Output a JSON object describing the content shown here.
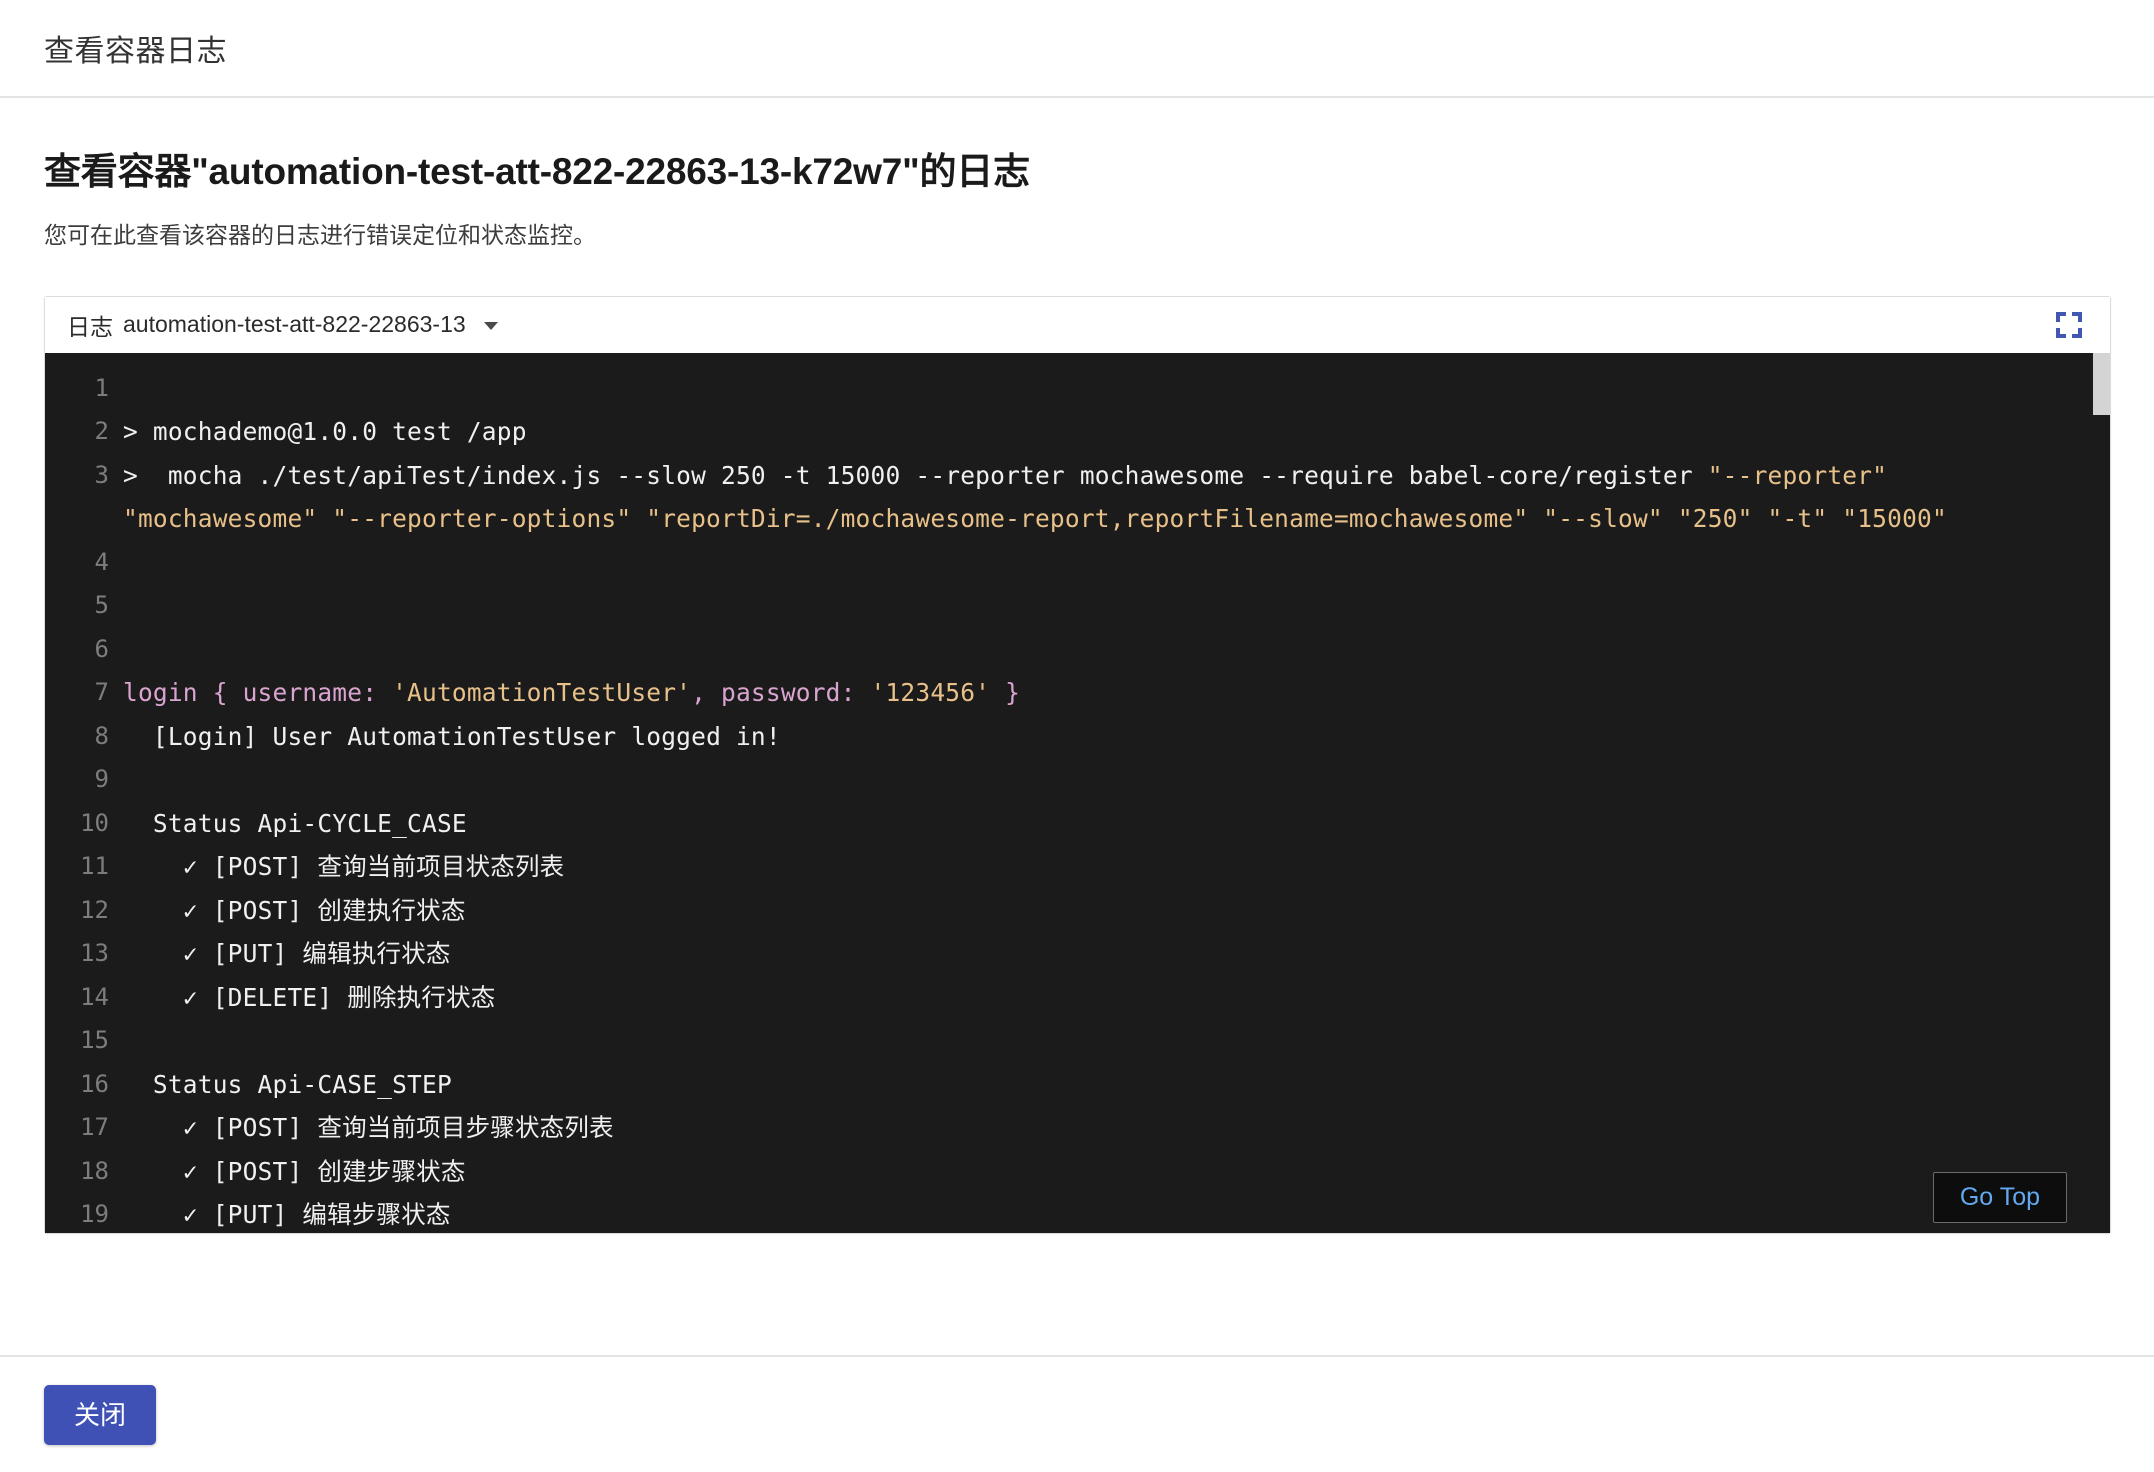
{
  "header": {
    "title": "查看容器日志"
  },
  "main": {
    "page_title": "查看容器\"automation-test-att-822-22863-13-k72w7\"的日志",
    "subtitle": "您可在此查看该容器的日志进行错误定位和状态监控。"
  },
  "log_panel": {
    "selector_label": "日志",
    "selector_value": "automation-test-att-822-22863-13",
    "caret_icon": "chevron-down-icon",
    "fullscreen_icon": "fullscreen-icon",
    "go_top_label": "Go Top",
    "scrollbar": {
      "thumb_position_pct": 0
    }
  },
  "footer": {
    "close_label": "关闭"
  },
  "colors": {
    "accent": "#3f51b5",
    "console_bg": "#1b1b1b",
    "console_text": "#d8d8d8",
    "string_orange": "#e8c08a",
    "keyword_purple": "#d9a5d0",
    "link_blue": "#62a9f0",
    "gutter_text": "#7d7d7d"
  },
  "log_lines": [
    {
      "num": "1",
      "segments": []
    },
    {
      "num": "2",
      "segments": [
        {
          "color": "white",
          "text": "> mochademo@1.0.0 test /app"
        }
      ]
    },
    {
      "num": "3",
      "segments": [
        {
          "color": "white",
          "text": ">  mocha ./test/apiTest/index.js --slow 250 -t 15000 --reporter mochawesome --require babel-core/register "
        },
        {
          "color": "orange",
          "text": "\"--reporter\" \"mochawesome\" \"--reporter-options\" \"reportDir=./mochawesome-report,reportFilename=mochawesome\" \"--slow\" \"250\" \"-t\" \"15000\""
        }
      ]
    },
    {
      "num": "4",
      "segments": []
    },
    {
      "num": "5",
      "segments": []
    },
    {
      "num": "6",
      "segments": []
    },
    {
      "num": "7",
      "segments": [
        {
          "color": "purple",
          "text": "login { username: "
        },
        {
          "color": "orange",
          "text": "'AutomationTestUser'"
        },
        {
          "color": "purple",
          "text": ", password: "
        },
        {
          "color": "orange",
          "text": "'123456'"
        },
        {
          "color": "purple",
          "text": " }"
        }
      ]
    },
    {
      "num": "8",
      "segments": [
        {
          "color": "white",
          "text": "  [Login] User AutomationTestUser logged in!"
        }
      ]
    },
    {
      "num": "9",
      "segments": []
    },
    {
      "num": "10",
      "segments": [
        {
          "color": "white",
          "text": "  Status Api-CYCLE_CASE"
        }
      ]
    },
    {
      "num": "11",
      "segments": [
        {
          "color": "white",
          "text": "    ✓ [POST] 查询当前项目状态列表"
        }
      ]
    },
    {
      "num": "12",
      "segments": [
        {
          "color": "white",
          "text": "    ✓ [POST] 创建执行状态"
        }
      ]
    },
    {
      "num": "13",
      "segments": [
        {
          "color": "white",
          "text": "    ✓ [PUT] 编辑执行状态"
        }
      ]
    },
    {
      "num": "14",
      "segments": [
        {
          "color": "white",
          "text": "    ✓ [DELETE] 删除执行状态"
        }
      ]
    },
    {
      "num": "15",
      "segments": []
    },
    {
      "num": "16",
      "segments": [
        {
          "color": "white",
          "text": "  Status Api-CASE_STEP"
        }
      ]
    },
    {
      "num": "17",
      "segments": [
        {
          "color": "white",
          "text": "    ✓ [POST] 查询当前项目步骤状态列表"
        }
      ]
    },
    {
      "num": "18",
      "segments": [
        {
          "color": "white",
          "text": "    ✓ [POST] 创建步骤状态"
        }
      ]
    },
    {
      "num": "19",
      "segments": [
        {
          "color": "white",
          "text": "    ✓ [PUT] 编辑步骤状态"
        }
      ]
    }
  ]
}
